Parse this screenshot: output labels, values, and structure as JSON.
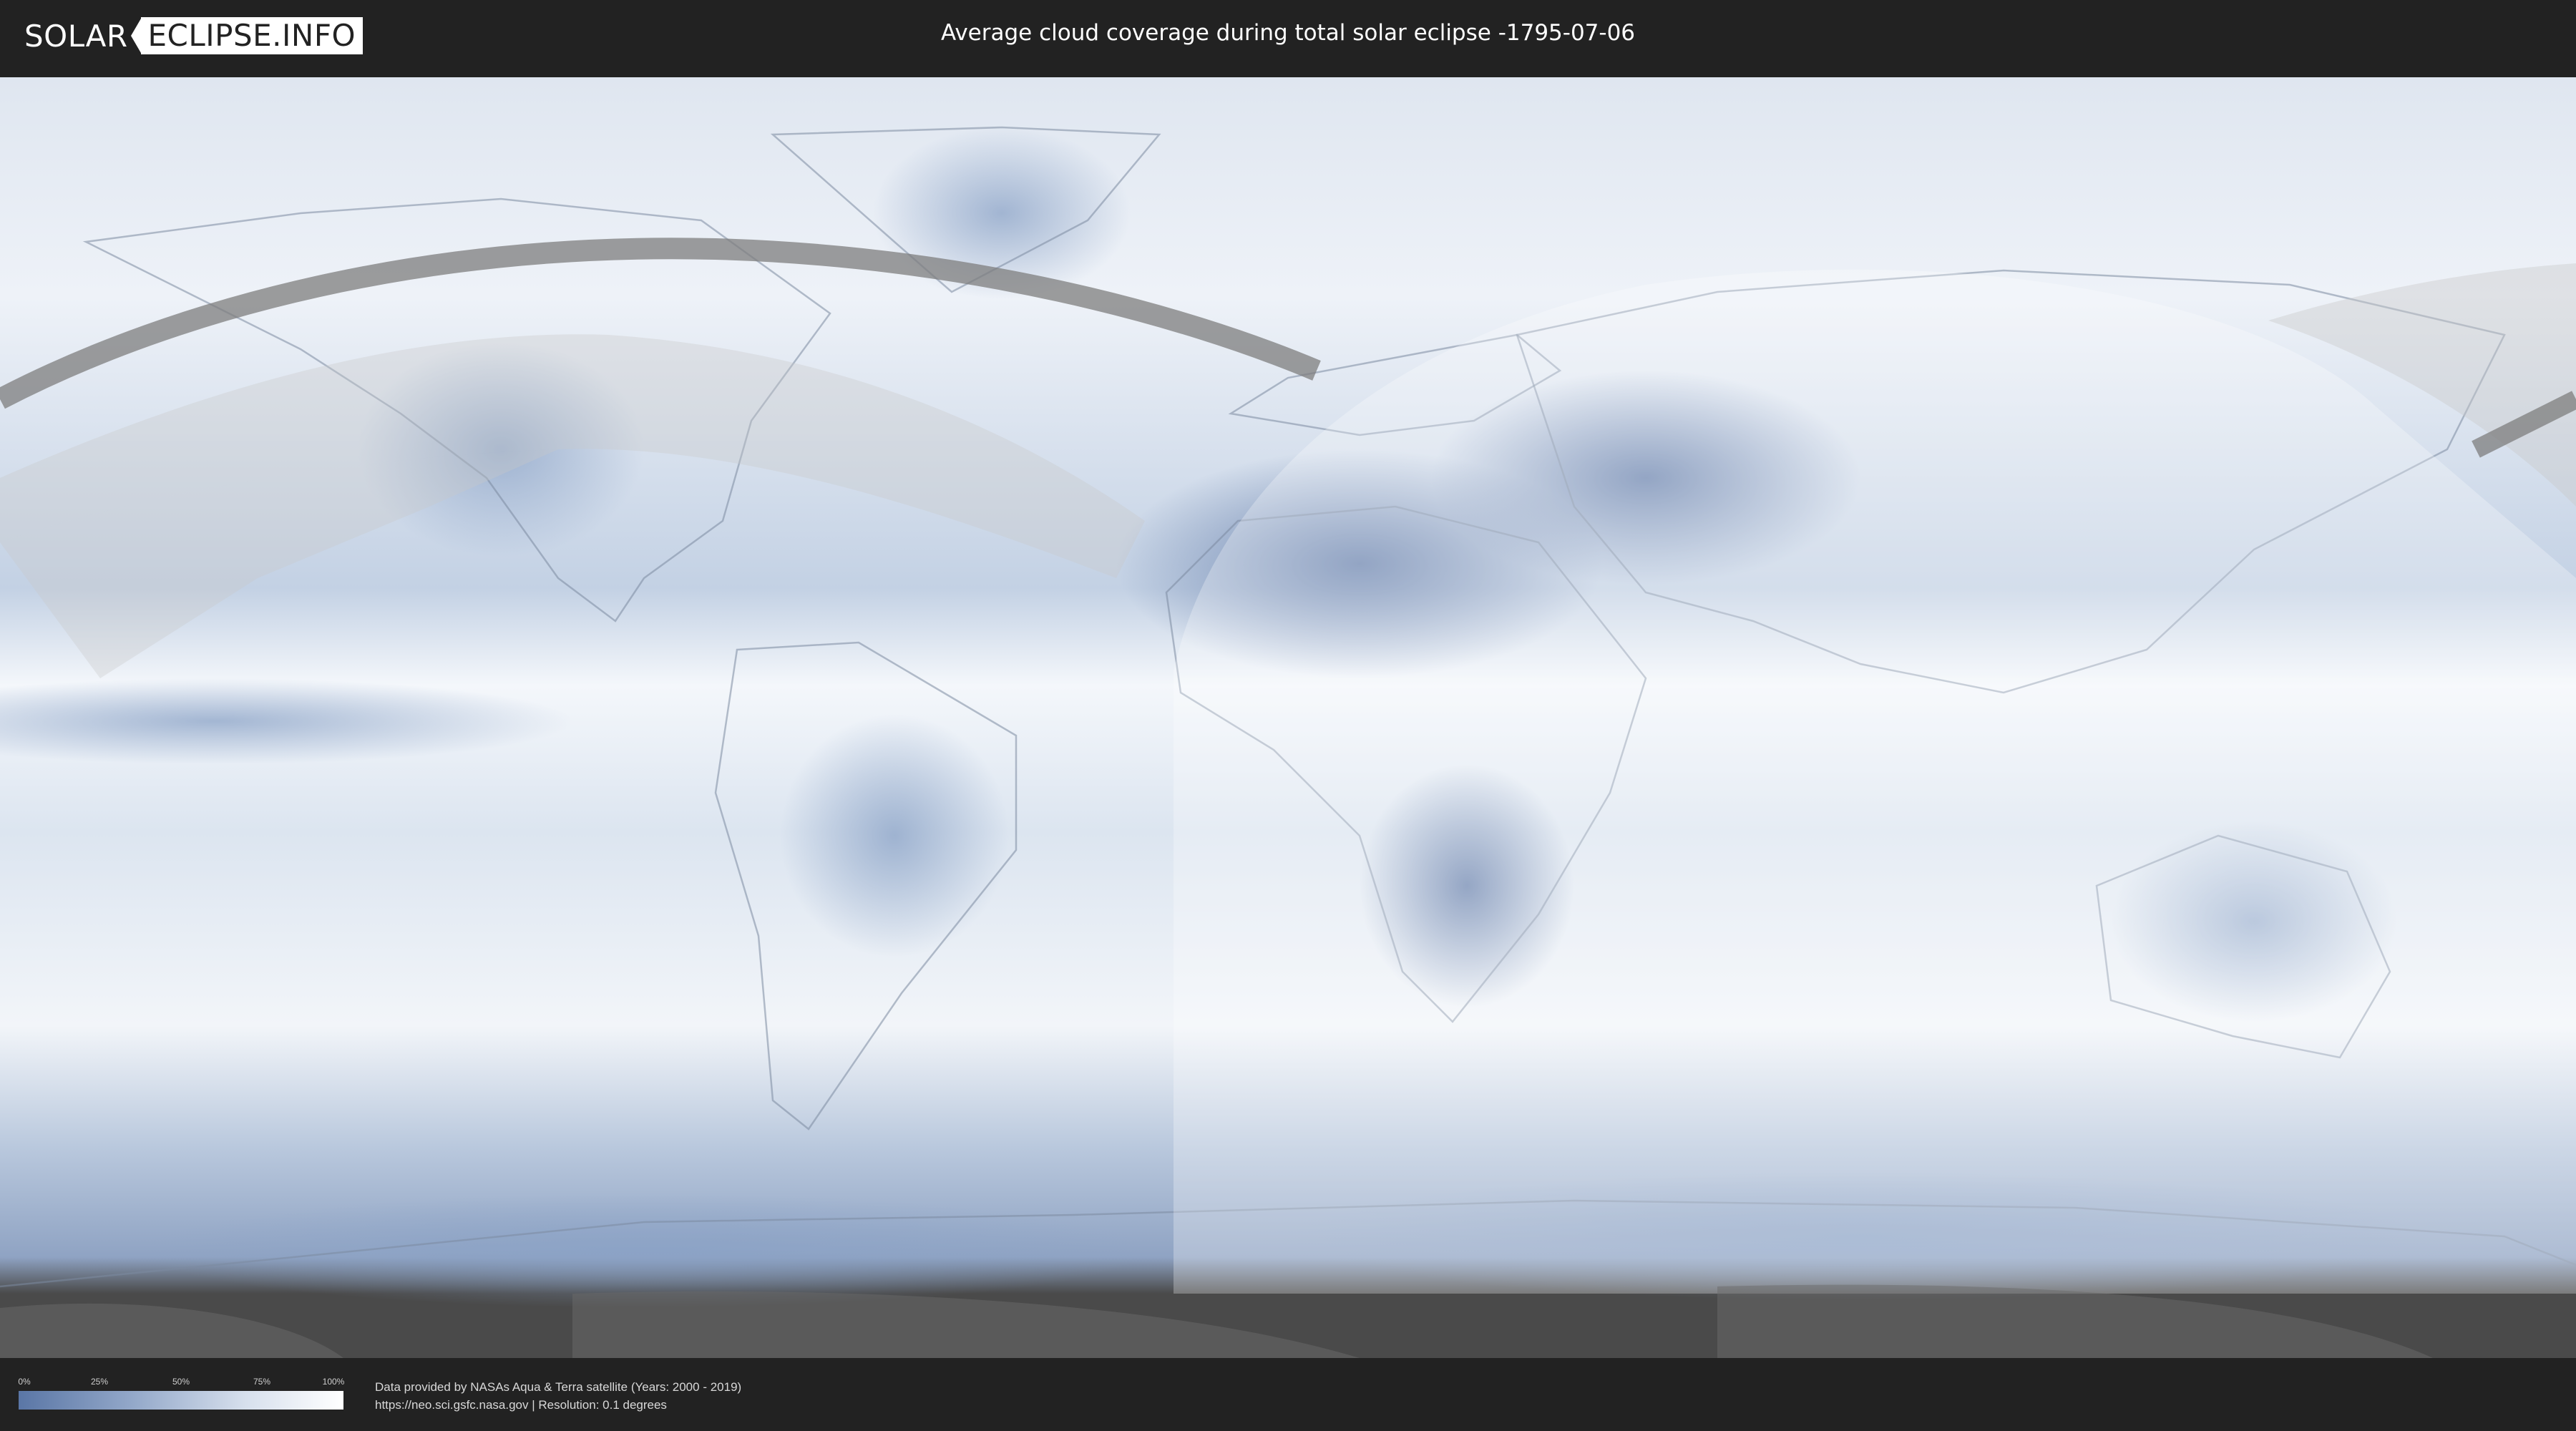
{
  "header": {
    "logo_part1": "SOLAR",
    "logo_part2": "ECLIPSE.INFO",
    "title": "Average cloud coverage during total solar eclipse -1795-07-06"
  },
  "legend": {
    "ticks": [
      "0%",
      "25%",
      "50%",
      "75%",
      "100%"
    ],
    "tick_values": [
      0,
      0.25,
      0.5,
      0.75,
      1.0
    ],
    "color_low": "#5a76a6",
    "color_high": "#ffffff"
  },
  "footer": {
    "credit_line1": "Data provided by NASAs Aqua & Terra satellite (Years: 2000 - 2019)",
    "credit_line2": "https://neo.sci.gsfc.nasa.gov | Resolution: 0.1 degrees"
  },
  "colors": {
    "background": "#222222",
    "cloud_light": "#ffffff",
    "cloud_dark": "#5a76a6",
    "eclipse_path": "#7d7d7d",
    "visibility_shade": "#9a9a9a"
  }
}
